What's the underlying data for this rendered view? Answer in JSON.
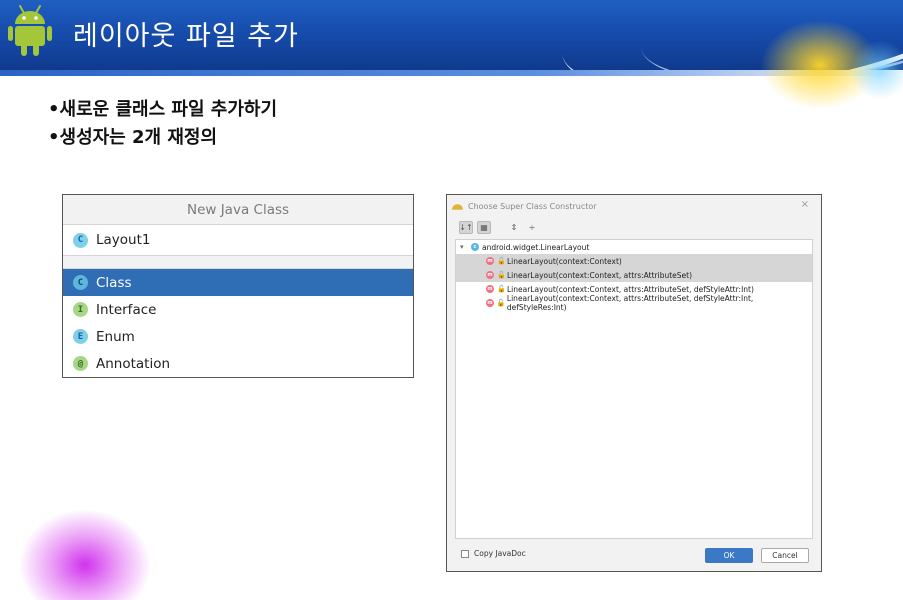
{
  "slide": {
    "title": "레이아웃 파일 추가",
    "bullets": [
      "•새로운 클래스 파일 추가하기",
      "•생성자는 2개 재정의"
    ]
  },
  "new_java_class": {
    "title": "New Java Class",
    "name_value": "Layout1",
    "name_icon": "C",
    "kinds": [
      {
        "label": "Class",
        "icon": "C",
        "selected": true
      },
      {
        "label": "Interface",
        "icon": "I",
        "selected": false
      },
      {
        "label": "Enum",
        "icon": "E",
        "selected": false
      },
      {
        "label": "Annotation",
        "icon": "@",
        "selected": false
      }
    ]
  },
  "super_dialog": {
    "title": "Choose Super Class Constructor",
    "close_icon": "×",
    "root": "android.widget.LinearLayout",
    "constructors": [
      {
        "label": "LinearLayout(context:Context)",
        "selected": true
      },
      {
        "label": "LinearLayout(context:Context, attrs:AttributeSet)",
        "selected": true
      },
      {
        "label": "LinearLayout(context:Context, attrs:AttributeSet, defStyleAttr:Int)",
        "selected": false
      },
      {
        "label": "LinearLayout(context:Context, attrs:AttributeSet, defStyleAttr:Int, defStyleRes:Int)",
        "selected": false
      }
    ],
    "copy_javadoc_label": "Copy JavaDoc",
    "ok_label": "OK",
    "cancel_label": "Cancel"
  },
  "colors": {
    "header_blue": "#1549a8",
    "selection_blue": "#2f6db5",
    "ok_blue": "#3b79c7",
    "glow_yellow": "#ffd628",
    "glow_magenta": "#cd28eb"
  }
}
